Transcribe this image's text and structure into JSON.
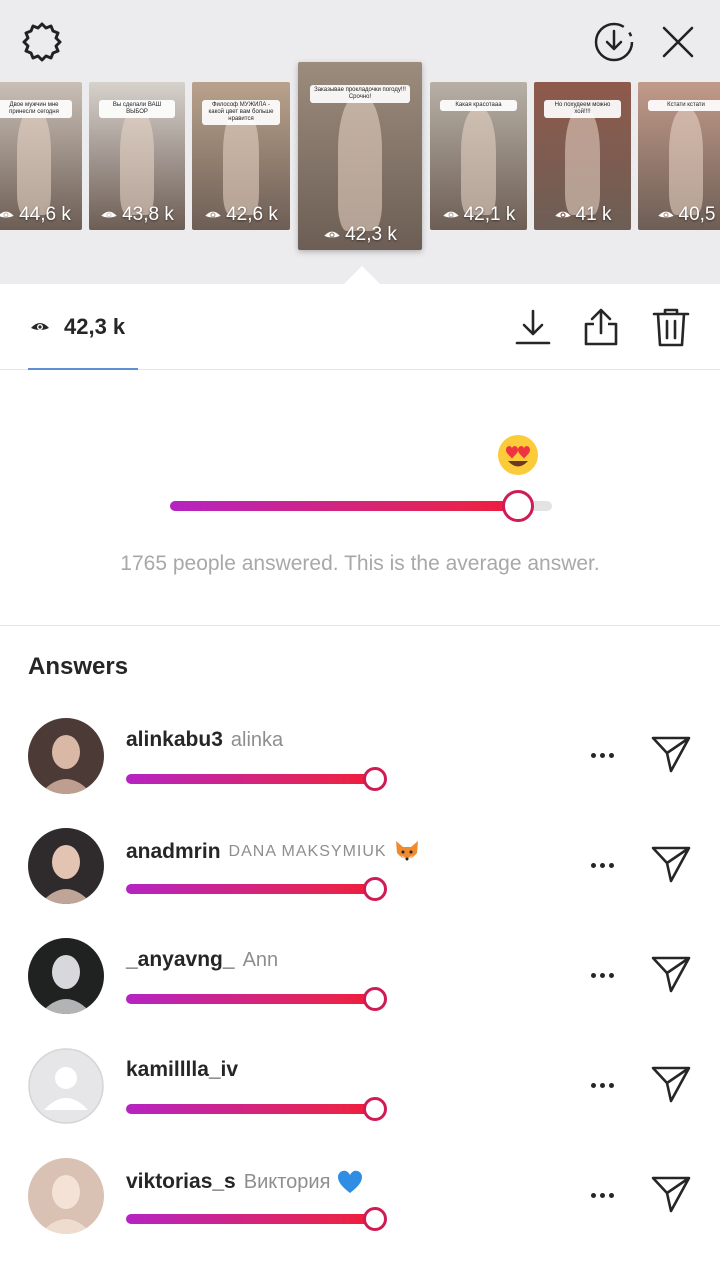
{
  "icons": {
    "settings": "gear-icon",
    "download_top": "download-circle-icon",
    "close": "close-icon",
    "eye": "eye-icon",
    "download": "download-icon",
    "share": "share-icon",
    "delete": "trash-icon",
    "more": "more-horizontal-icon",
    "send": "direct-send-icon"
  },
  "stories": [
    {
      "views": "44,6 k",
      "caption": "Двое мужчин мне принесли сегодня",
      "selected": false,
      "bg": "#c9bfb6"
    },
    {
      "views": "43,8 k",
      "caption": "Вы сделали ВАШ ВЫБОР",
      "selected": false,
      "bg": "#d7d1cc"
    },
    {
      "views": "42,6 k",
      "caption": "Философ МУЖИЛА - какой цвет вам больше нравится",
      "selected": false,
      "bg": "#b9a28c"
    },
    {
      "views": "42,3 k",
      "caption": "Заказывае прокладочки погоду!!! Срочно!",
      "selected": true,
      "bg": "#9c8c7d"
    },
    {
      "views": "42,1 k",
      "caption": "Какая красотааа",
      "selected": false,
      "bg": "#b7b0a6"
    },
    {
      "views": "41 k",
      "caption": "Но похудеем можно хой!!!!",
      "selected": false,
      "bg": "#8f5a4c"
    },
    {
      "views": "40,5",
      "caption": "Кстати кстати",
      "selected": false,
      "bg": "#c19a8a"
    }
  ],
  "viewer": {
    "views_count": "42,3 k"
  },
  "result": {
    "emoji": "heart-eyes-emoji",
    "average": 0.91,
    "summary": "1765 people answered. This is the average answer."
  },
  "answers": {
    "heading": "Answers",
    "items": [
      {
        "handle": "alinkabu3",
        "name": "alinka",
        "name_style": "normal",
        "emoji": "",
        "value": 0.95,
        "avatar_bg": "#4b3a35",
        "avatar_fg": "#d9b8a6"
      },
      {
        "handle": "anadmrin",
        "name": "DANA MAKSYMIUK",
        "name_style": "smallcaps",
        "emoji": "fox-emoji",
        "value": 0.95,
        "avatar_bg": "#2f2a2c",
        "avatar_fg": "#e3c4b3"
      },
      {
        "handle": "_anyavng_",
        "name": "Ann",
        "name_style": "serif",
        "emoji": "",
        "value": 0.95,
        "avatar_bg": "#1f2220",
        "avatar_fg": "#d8d8dc"
      },
      {
        "handle": "kamilllla_iv",
        "name": "",
        "name_style": "normal",
        "emoji": "",
        "value": 0.95,
        "avatar_bg": "#e6e6e8",
        "avatar_fg": "#ffffff",
        "placeholder": true
      },
      {
        "handle": "viktorias_s",
        "name": "Виктория",
        "name_style": "normal",
        "emoji": "blue-heart-emoji",
        "value": 0.95,
        "avatar_bg": "#d9c1b4",
        "avatar_fg": "#f3e2d5"
      }
    ]
  }
}
